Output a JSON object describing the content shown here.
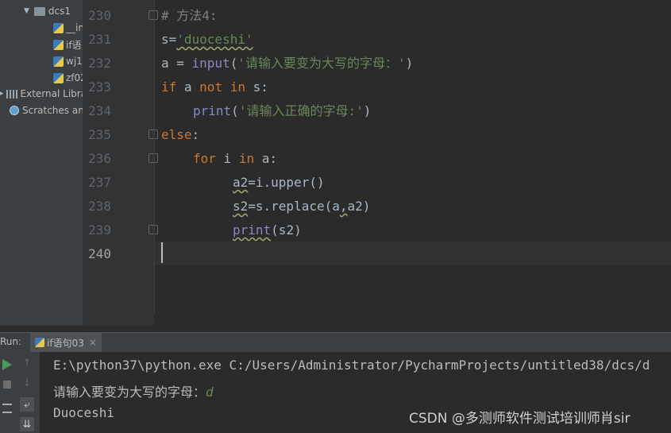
{
  "project": {
    "root": "dcs1",
    "files": [
      "__in",
      "if语",
      "wj1",
      "zf02"
    ],
    "external": "External Libra",
    "scratches": "Scratches an"
  },
  "editor": {
    "line_numbers": [
      "230",
      "231",
      "232",
      "233",
      "234",
      "235",
      "236",
      "237",
      "238",
      "239",
      "240"
    ],
    "lines": {
      "l230": "# 方法4:",
      "l231_a": "s=",
      "l231_b": "'duoceshi'",
      "l232_a": "a = ",
      "l232_b": "input",
      "l232_c": "(",
      "l232_d": "'请输入要变为大写的字母：'",
      "l232_e": ")",
      "l233_a": "if",
      "l233_b": " a ",
      "l233_c": "not in",
      "l233_d": " s:",
      "l234_a": "print",
      "l234_b": "(",
      "l234_c": "'请输入正确的字母:'",
      "l234_d": ")",
      "l235_a": "else",
      "l235_b": ":",
      "l236_a": "for",
      "l236_b": " i ",
      "l236_c": "in",
      "l236_d": " a:",
      "l237_a": "a2",
      "l237_b": "=i.upper()",
      "l238_a": "s2",
      "l238_b": "=s.replace(a",
      "l238_c": ",",
      "l238_d": "a2)",
      "l239_a": "print",
      "l239_b": "(s2)"
    }
  },
  "run": {
    "label": "Run:",
    "tab": "if语句03",
    "close": "×",
    "output": {
      "cmd": "E:\\python37\\python.exe C:/Users/Administrator/PycharmProjects/untitled38/dcs/d",
      "prompt": "请输入要变为大写的字母：",
      "input": "d",
      "result": "Duoceshi"
    }
  },
  "watermark": "CSDN @多测师软件测试培训师肖sir",
  "colors": {
    "keyword": "#cc7832",
    "string": "#6a8759",
    "comment": "#808080",
    "builtin": "#8888c6",
    "run": "#499c54"
  }
}
